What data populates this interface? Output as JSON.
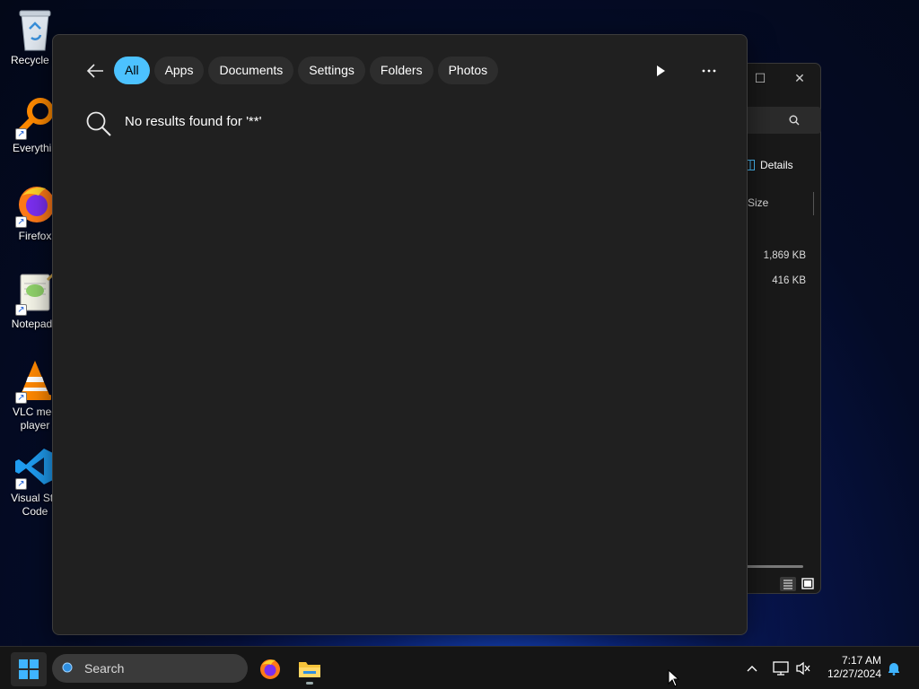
{
  "desktop": {
    "icons": [
      {
        "label": "Recycle B",
        "icon": "recycle-bin-icon"
      },
      {
        "label": "Everythin",
        "icon": "everything-search-icon"
      },
      {
        "label": "Firefox",
        "icon": "firefox-icon"
      },
      {
        "label": "Notepad+",
        "icon": "notepad-plus-plus-icon"
      },
      {
        "label": "VLC med\nplayer",
        "icon": "vlc-icon"
      },
      {
        "label": "Visual Stu\nCode",
        "icon": "vscode-icon"
      }
    ]
  },
  "explorer": {
    "details_label": "Details",
    "size_header": "Size",
    "rows": [
      {
        "size": "1,869 KB"
      },
      {
        "size": "416 KB"
      }
    ]
  },
  "search_panel": {
    "filters": [
      {
        "label": "All",
        "active": true
      },
      {
        "label": "Apps",
        "active": false
      },
      {
        "label": "Documents",
        "active": false
      },
      {
        "label": "Settings",
        "active": false
      },
      {
        "label": "Folders",
        "active": false
      },
      {
        "label": "Photos",
        "active": false
      }
    ],
    "no_results_text": "No results found for '**'"
  },
  "taskbar": {
    "search_placeholder": "Search",
    "pinned_apps": [
      "firefox-icon",
      "file-explorer-icon"
    ],
    "time": "7:17 AM",
    "date": "12/27/2024"
  },
  "colors": {
    "accent": "#4cc2ff",
    "panel_bg": "#202020",
    "pill_bg": "#2d2d2d",
    "taskbar_bg": "#151515"
  }
}
